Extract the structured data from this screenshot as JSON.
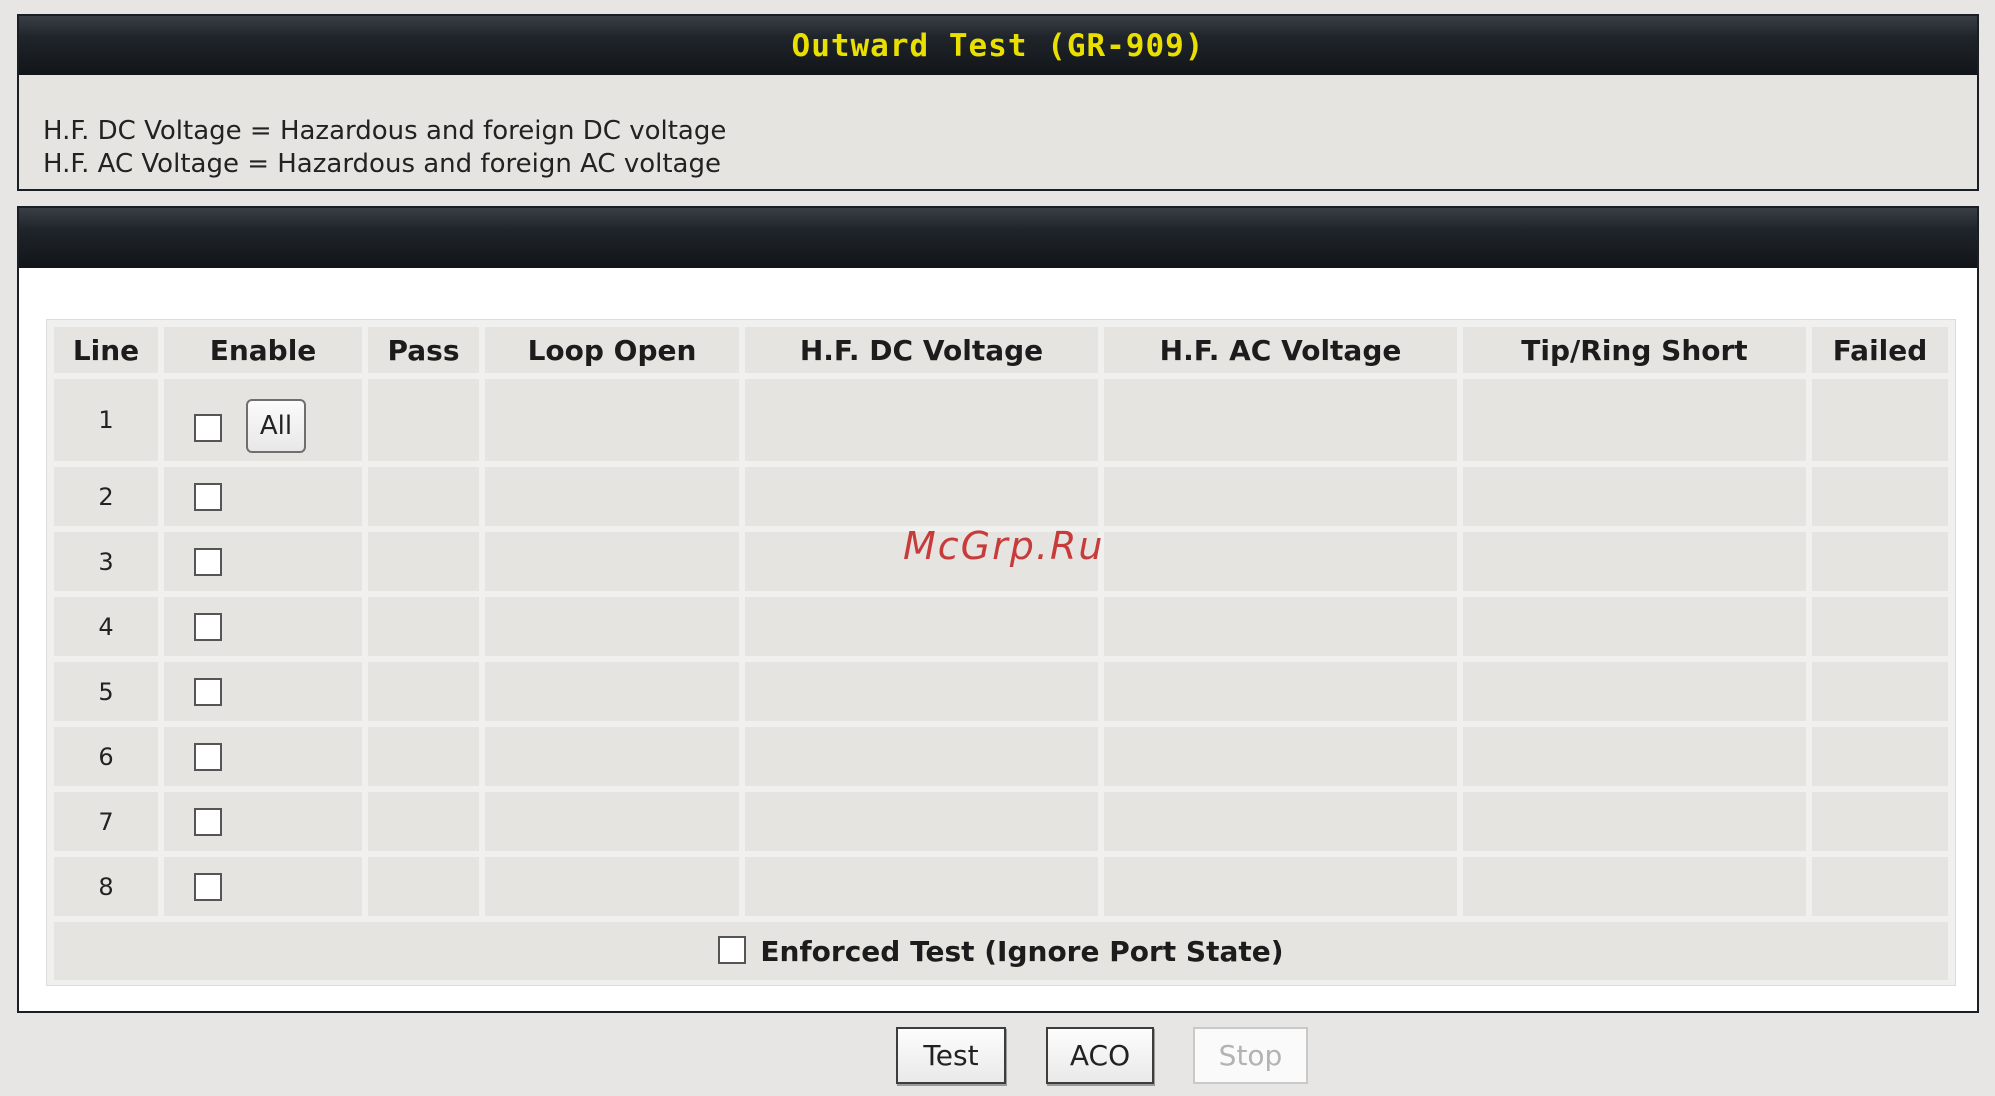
{
  "header": {
    "title": "Outward Test (GR-909)"
  },
  "legend": [
    "H.F. DC Voltage = Hazardous and foreign DC voltage",
    "H.F. AC Voltage = Hazardous and foreign AC voltage"
  ],
  "table": {
    "columns": [
      "Line",
      "Enable",
      "Pass",
      "Loop Open",
      "H.F. DC Voltage",
      "H.F. AC Voltage",
      "Tip/Ring Short",
      "Failed"
    ],
    "rows": [
      {
        "line": "1",
        "enabled": false
      },
      {
        "line": "2",
        "enabled": false
      },
      {
        "line": "3",
        "enabled": false
      },
      {
        "line": "4",
        "enabled": false
      },
      {
        "line": "5",
        "enabled": false
      },
      {
        "line": "6",
        "enabled": false
      },
      {
        "line": "7",
        "enabled": false
      },
      {
        "line": "8",
        "enabled": false
      }
    ],
    "all_button_label": "All",
    "enforced_test_label": "Enforced Test (Ignore Port State)",
    "enforced_test_checked": false
  },
  "buttons": {
    "test_label": "Test",
    "aco_label": "ACO",
    "stop_label": "Stop",
    "stop_disabled": true
  },
  "watermark": "McGrp.Ru",
  "colors": {
    "title_text": "#e9e000",
    "bar_dark": "#111519",
    "cell_bg": "#e5e4e1",
    "watermark": "#c83b3b"
  }
}
